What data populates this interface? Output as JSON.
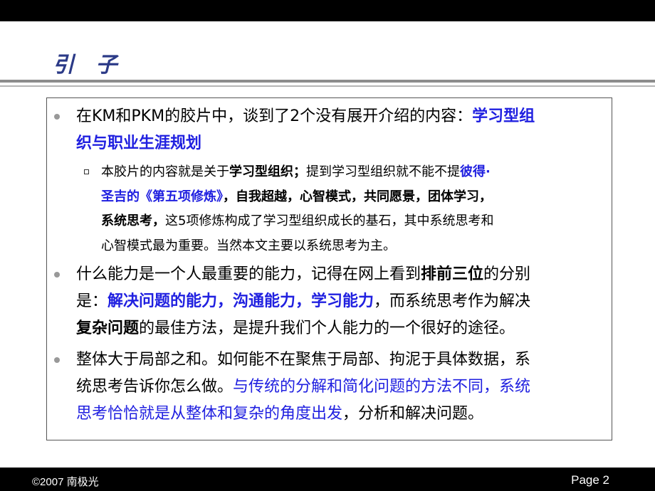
{
  "slide": {
    "title": "引 子",
    "footer_left": "©2007 南极光",
    "footer_right": "Page 2"
  },
  "bullets": [
    {
      "level": 1,
      "lines": [
        [
          {
            "t": "在KM和PKM的胶片中，谈到了2个没有展开介绍的内容："
          },
          {
            "t": "学习型组",
            "b": true,
            "blue": true
          }
        ],
        [
          {
            "t": "织与职业生涯规划",
            "b": true,
            "blue": true
          }
        ]
      ]
    },
    {
      "level": 2,
      "lines": [
        [
          {
            "t": "本胶片的内容就是关于"
          },
          {
            "t": "学习型组织；",
            "b": true
          },
          {
            "t": "提到学习型组织就不能不提"
          },
          {
            "t": "彼得·",
            "b": true,
            "blue": true
          }
        ],
        [
          {
            "t": "圣吉的《第五项修炼》",
            "b": true,
            "blue": true
          },
          {
            "t": "，自我超越，心智模式，共同愿景，团体学习，",
            "b": true
          }
        ],
        [
          {
            "t": "系统思考，",
            "b": true
          },
          {
            "t": "这5项修炼构成了学习型组织成长的基石，其中系统思考和"
          }
        ],
        [
          {
            "t": "心智模式最为重要。当然本文主要以系统思考为主。"
          }
        ]
      ]
    },
    {
      "level": 1,
      "lines": [
        [
          {
            "t": "什么能力是一个人最重要的能力，记得在网上看到"
          },
          {
            "t": "排前三位",
            "b": true
          },
          {
            "t": "的分别"
          }
        ],
        [
          {
            "t": "是："
          },
          {
            "t": "解决问题的能力，沟通能力，学习能力",
            "b": true,
            "blue": true
          },
          {
            "t": "，而系统思考作为解决"
          }
        ],
        [
          {
            "t": "复杂问题",
            "b": true
          },
          {
            "t": "的最佳方法，是提升我们个人能力的一个很好的途径。"
          }
        ]
      ]
    },
    {
      "level": 1,
      "lines": [
        [
          {
            "t": "整体大于局部之和。如何能不在聚焦于局部、拘泥于具体数据，系"
          }
        ],
        [
          {
            "t": "统思考告诉你怎么做。"
          },
          {
            "t": "与传统的分解和简化问题的方法不同，系统",
            "blue": true
          }
        ],
        [
          {
            "t": "思考恰恰就是从整体和复杂的角度出发",
            "blue": true
          },
          {
            "t": "，分析和解决问题。"
          }
        ]
      ]
    }
  ]
}
